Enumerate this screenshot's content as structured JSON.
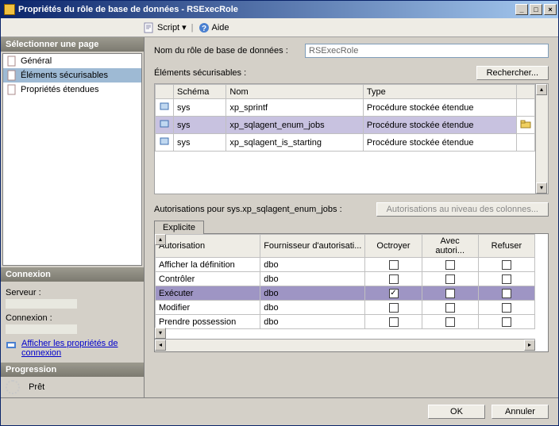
{
  "window": {
    "title": "Propriétés du rôle de base de données - RSExecRole",
    "min": "_",
    "max": "□",
    "close": "×"
  },
  "toolbar": {
    "script": "Script",
    "help": "Aide"
  },
  "left": {
    "select_page": "Sélectionner une page",
    "nav": {
      "general": "Général",
      "securables": "Éléments sécurisables",
      "extended": "Propriétés étendues"
    },
    "connexion_hd": "Connexion",
    "server_label": "Serveur :",
    "conn_label": "Connexion :",
    "view_props": "Afficher les propriétés de connexion",
    "progress_hd": "Progression",
    "ready": "Prêt"
  },
  "main": {
    "role_name_label": "Nom du rôle de base de données :",
    "role_name_value": "RSExecRole",
    "securables_label": "Éléments sécurisables :",
    "search_btn": "Rechercher...",
    "grid_headers": {
      "schema": "Schéma",
      "name": "Nom",
      "type": "Type"
    },
    "rows": [
      {
        "schema": "sys",
        "name": "xp_sprintf",
        "type": "Procédure stockée étendue"
      },
      {
        "schema": "sys",
        "name": "xp_sqlagent_enum_jobs",
        "type": "Procédure stockée étendue"
      },
      {
        "schema": "sys",
        "name": "xp_sqlagent_is_starting",
        "type": "Procédure stockée étendue"
      }
    ],
    "perm_label": "Autorisations pour sys.xp_sqlagent_enum_jobs :",
    "col_perms_btn": "Autorisations au niveau des colonnes...",
    "tab_explicit": "Explicite",
    "perm_headers": {
      "perm": "Autorisation",
      "grantor": "Fournisseur d'autorisati...",
      "grant": "Octroyer",
      "with_grant": "Avec autori...",
      "deny": "Refuser"
    },
    "perm_rows": [
      {
        "perm": "Afficher la définition",
        "grantor": "dbo",
        "grant": false,
        "with_grant": false,
        "deny": false
      },
      {
        "perm": "Contrôler",
        "grantor": "dbo",
        "grant": false,
        "with_grant": false,
        "deny": false
      },
      {
        "perm": "Exécuter",
        "grantor": "dbo",
        "grant": true,
        "with_grant": false,
        "deny": false
      },
      {
        "perm": "Modifier",
        "grantor": "dbo",
        "grant": false,
        "with_grant": false,
        "deny": false
      },
      {
        "perm": "Prendre possession",
        "grantor": "dbo",
        "grant": false,
        "with_grant": false,
        "deny": false
      }
    ]
  },
  "footer": {
    "ok": "OK",
    "cancel": "Annuler"
  }
}
